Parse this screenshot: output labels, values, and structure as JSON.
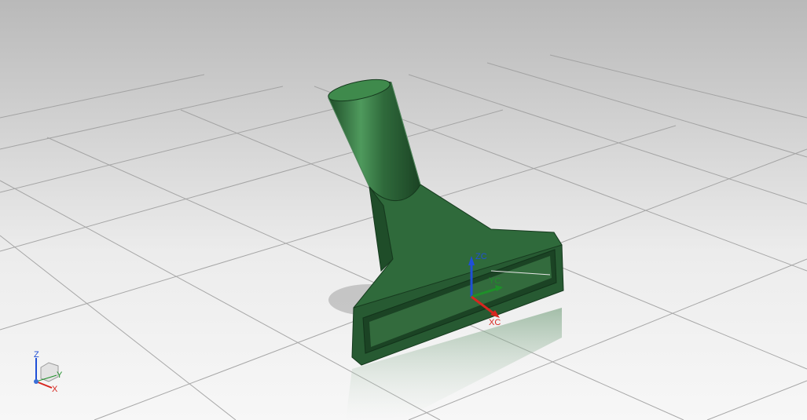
{
  "viewport": {
    "model_color": "#2f6a3b",
    "highlight_color": "#5fa36a",
    "floor_line_color": "#a9a9a9"
  },
  "wcs": {
    "xc": "XC",
    "yc": "YC",
    "zc": "ZC",
    "xc_color": "#d7261f",
    "yc_color": "#1f8f2a",
    "zc_color": "#1f4fd7"
  },
  "triad": {
    "x": "X",
    "y": "Y",
    "z": "Z"
  }
}
